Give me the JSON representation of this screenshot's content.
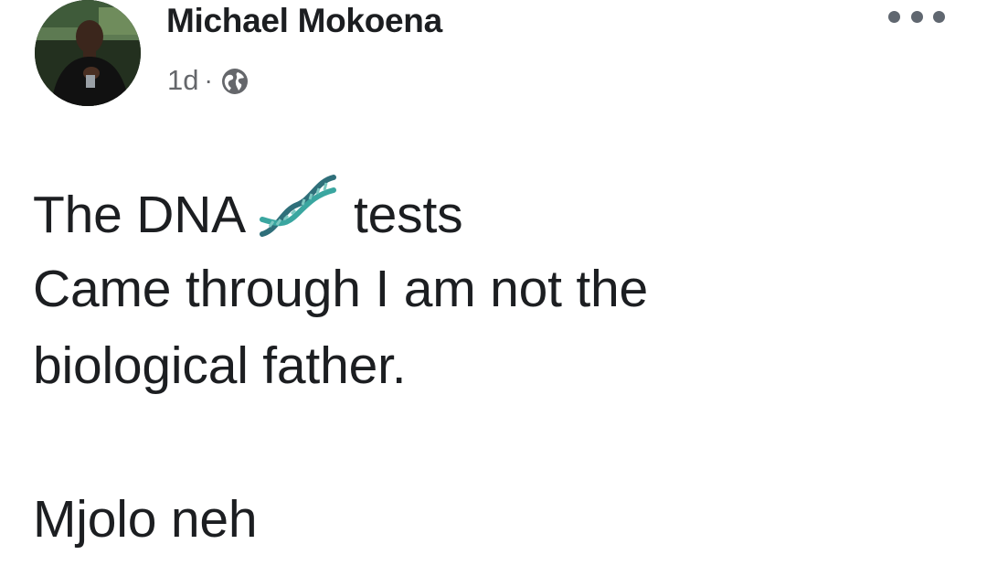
{
  "post": {
    "author": {
      "name": "Michael Mokoena",
      "avatar_icon": "profile-photo"
    },
    "meta": {
      "time": "1d",
      "separator": "·",
      "audience_icon": "globe-icon"
    },
    "more_options_icon": "more-horizontal-icon",
    "body": {
      "line1_before": "The DNA",
      "line1_emoji": "dna-emoji",
      "line1_after": "tests",
      "line2": "Came through I am not the",
      "line3": "biological father.",
      "line5": "Mjolo neh"
    }
  },
  "colors": {
    "text": "#1c1e21",
    "meta": "#65676b",
    "dna_teal": "#3aa6a0",
    "dna_dark": "#2c5f6e"
  }
}
